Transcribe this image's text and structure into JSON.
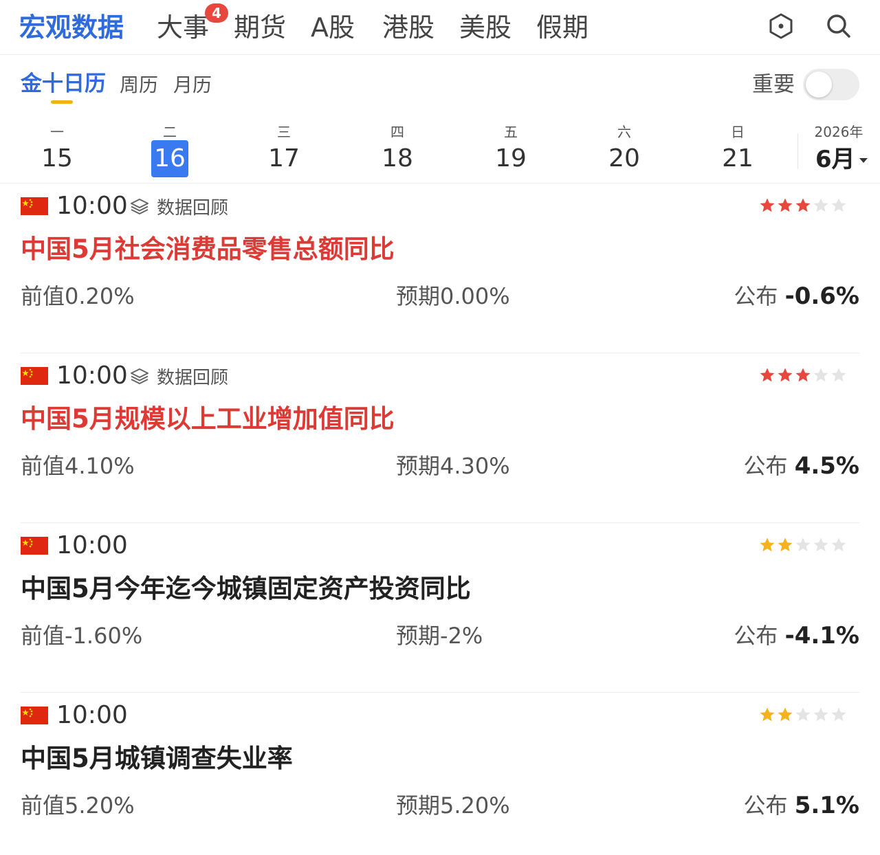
{
  "top_nav": {
    "tabs": [
      "宏观数据",
      "大事",
      "期货",
      "A股",
      "港股",
      "美股",
      "假期"
    ],
    "active_index": 0,
    "badge": {
      "tab_index": 1,
      "count": "4"
    },
    "icons": [
      "hexagon-icon",
      "search-icon"
    ]
  },
  "sub_nav": {
    "tabs": [
      "金十日历",
      "周历",
      "月历"
    ],
    "active_index": 0,
    "important_label": "重要",
    "important_on": false
  },
  "week": {
    "days": [
      {
        "weekday": "一",
        "date": "15"
      },
      {
        "weekday": "二",
        "date": "16"
      },
      {
        "weekday": "三",
        "date": "17"
      },
      {
        "weekday": "四",
        "date": "18"
      },
      {
        "weekday": "五",
        "date": "19"
      },
      {
        "weekday": "六",
        "date": "20"
      },
      {
        "weekday": "日",
        "date": "21"
      }
    ],
    "selected_index": 1,
    "year": "2026年",
    "month": "6月"
  },
  "labels": {
    "prev": "前值",
    "expected": "预期",
    "published": "公布"
  },
  "events": [
    {
      "time": "10:00",
      "review": "数据回顾",
      "title": "中国5月社会消费品零售总额同比",
      "title_color": "red",
      "stars": 3,
      "star_color": "red",
      "prev": "0.20%",
      "expected": "0.00%",
      "published": "-0.6%"
    },
    {
      "time": "10:00",
      "review": "数据回顾",
      "title": "中国5月规模以上工业增加值同比",
      "title_color": "red",
      "stars": 3,
      "star_color": "red",
      "prev": "4.10%",
      "expected": "4.30%",
      "published": "4.5%"
    },
    {
      "time": "10:00",
      "review": "",
      "title": "中国5月今年迄今城镇固定资产投资同比",
      "title_color": "dark",
      "stars": 2,
      "star_color": "gold",
      "prev": "-1.60%",
      "expected": "-2%",
      "published": "-4.1%"
    },
    {
      "time": "10:00",
      "review": "",
      "title": "中国5月城镇调查失业率",
      "title_color": "dark",
      "stars": 2,
      "star_color": "gold",
      "prev": "5.20%",
      "expected": "5.20%",
      "published": "5.1%"
    }
  ],
  "colors": {
    "accent": "#2f6bdc",
    "selected_day": "#3a7af0",
    "title_red": "#db3a35",
    "star_red": "#e8473d",
    "star_gold": "#f5b21c",
    "star_empty": "#e4e4e4"
  }
}
